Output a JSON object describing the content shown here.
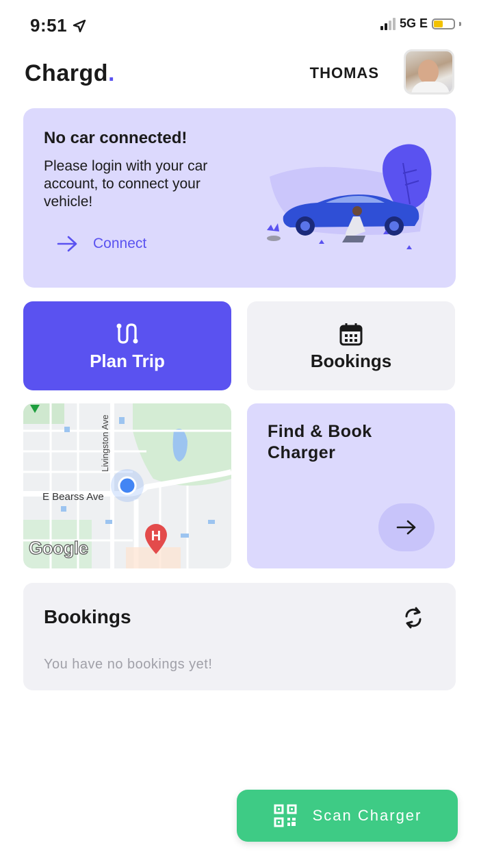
{
  "status_bar": {
    "time": "9:51",
    "network": "5G E",
    "battery_level": 0.45
  },
  "header": {
    "logo": "Chargd",
    "logo_dot": ".",
    "user_name": "THOMAS"
  },
  "car_card": {
    "title": "No car connected!",
    "description": "Please login with your car account, to connect your vehicle!",
    "connect_label": "Connect"
  },
  "tiles": {
    "plan_trip": "Plan Trip",
    "bookings": "Bookings",
    "find_charger": "Find & Book Charger"
  },
  "map": {
    "street_vertical": "Livingston Ave",
    "street_horizontal": "E Bearss Ave",
    "attribution": "Google",
    "poi_marker": "H"
  },
  "bookings_panel": {
    "title": "Bookings",
    "empty_text": "You have no bookings yet!"
  },
  "scan_button": {
    "label": "Scan Charger"
  },
  "colors": {
    "accent": "#5a52f0",
    "card_lavender": "#dcd9fd",
    "scan_green": "#3ecb85"
  }
}
